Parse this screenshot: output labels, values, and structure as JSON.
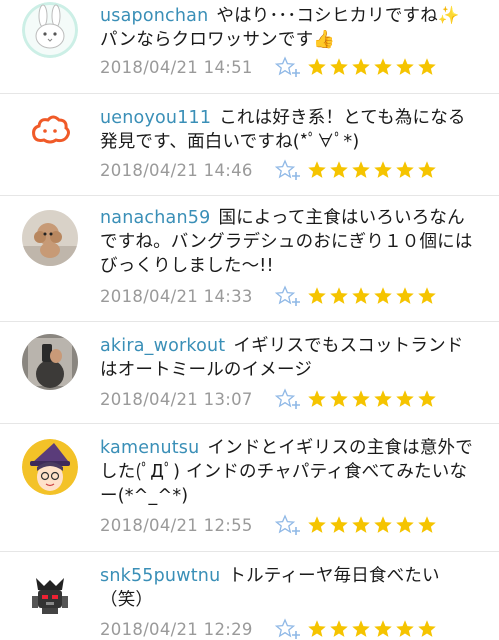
{
  "comments": [
    {
      "user": "usaponchan",
      "text": "やはり･･･コシヒカリですね✨パンならクロワッサンです👍",
      "time": "2018/04/21 14:51",
      "rating": 6,
      "avatar": "white-rabbit"
    },
    {
      "user": "uenoyou111",
      "text": "これは好き系！とても為になる発見です、面白いですね(*ﾟ∀ﾟ*)",
      "time": "2018/04/21 14:46",
      "rating": 6,
      "avatar": "orange-cloud"
    },
    {
      "user": "nanachan59",
      "text": "国によって主食はいろいろなんですね。バングラデシュのおにぎり１０個にはびっくりしました〜!!",
      "time": "2018/04/21 14:33",
      "rating": 6,
      "avatar": "toy-poodle-photo"
    },
    {
      "user": "akira_workout",
      "text": "イギリスでもスコットランドはオートミールのイメージ",
      "time": "2018/04/21 13:07",
      "rating": 6,
      "avatar": "mirror-selfie-photo"
    },
    {
      "user": "kamenutsu",
      "text": "インドとイギリスの主食は意外でした(ﾟДﾟ) インドのチャパティ食べてみたいなー(*^_^*)",
      "time": "2018/04/21 12:55",
      "rating": 6,
      "avatar": "witch-girl"
    },
    {
      "user": "snk55puwtnu",
      "text": "トルティーヤ毎日食べたい（笑）",
      "time": "2018/04/21 12:29",
      "rating": 6,
      "avatar": "robot"
    }
  ],
  "colors": {
    "username": "#3a8fb7",
    "star": "#f5c400",
    "timestamp": "#9a9a9a",
    "fav_icon": "#8fb8e6"
  },
  "icons": {
    "favorite": "star-plus-icon",
    "rating": "star-icon"
  }
}
